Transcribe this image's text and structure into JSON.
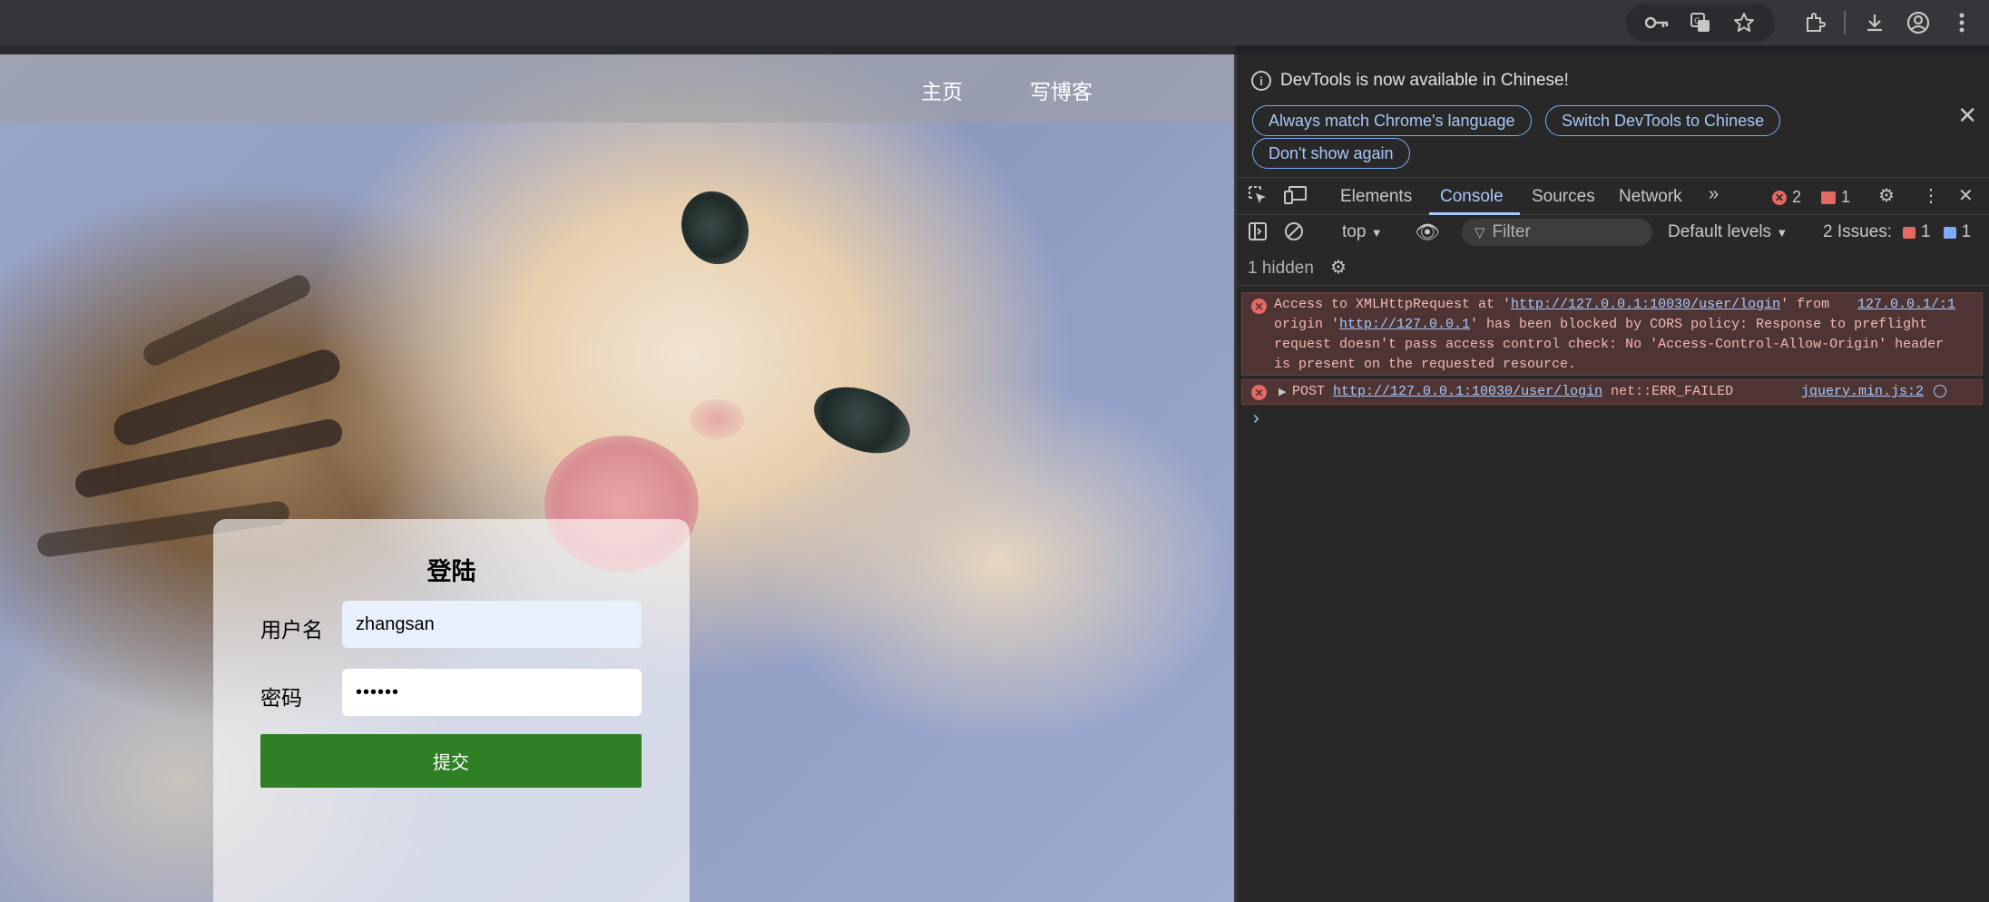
{
  "browser": {
    "icons": [
      "key-icon",
      "translate-icon",
      "star-icon",
      "extension-icon",
      "download-icon",
      "account-icon",
      "menu-icon"
    ]
  },
  "page": {
    "nav": {
      "home": "主页",
      "write_blog": "写博客"
    },
    "login": {
      "title": "登陆",
      "username_label": "用户名",
      "username_value": "zhangsan",
      "password_label": "密码",
      "password_value": "••••••",
      "submit_label": "提交"
    }
  },
  "devtools": {
    "infobar": {
      "message": "DevTools is now available in Chinese!",
      "btn_match": "Always match Chrome's language",
      "btn_switch": "Switch DevTools to Chinese",
      "btn_dont_show": "Don't show again"
    },
    "tabs": [
      "Elements",
      "Console",
      "Sources",
      "Network"
    ],
    "active_tab": "Console",
    "error_count": "2",
    "warning_count": "1",
    "toolbar": {
      "context": "top",
      "filter_placeholder": "Filter",
      "levels": "Default levels",
      "issues_label": "2 Issues:",
      "issues_error": "1",
      "issues_info": "1"
    },
    "hidden": "1 hidden",
    "messages": {
      "m1_part1": "Access to XMLHttpRequest at '",
      "m1_url": "http://127.0.0.1:10030/user/login",
      "m1_part2": "' from",
      "m1_origin_label": "origin '",
      "m1_origin": "http://127.0.0.1",
      "m1_part3": "' has been blocked by CORS policy: Response to preflight",
      "m1_line3": "request doesn't pass access control check: No 'Access-Control-Allow-Origin' header",
      "m1_line4": "is present on the requested resource.",
      "m1_source": "127.0.0.1/:1",
      "m2_method": "POST",
      "m2_url": "http://127.0.0.1:10030/user/login",
      "m2_status": "net::ERR_FAILED",
      "m2_source": "jquery.min.js:2"
    }
  }
}
